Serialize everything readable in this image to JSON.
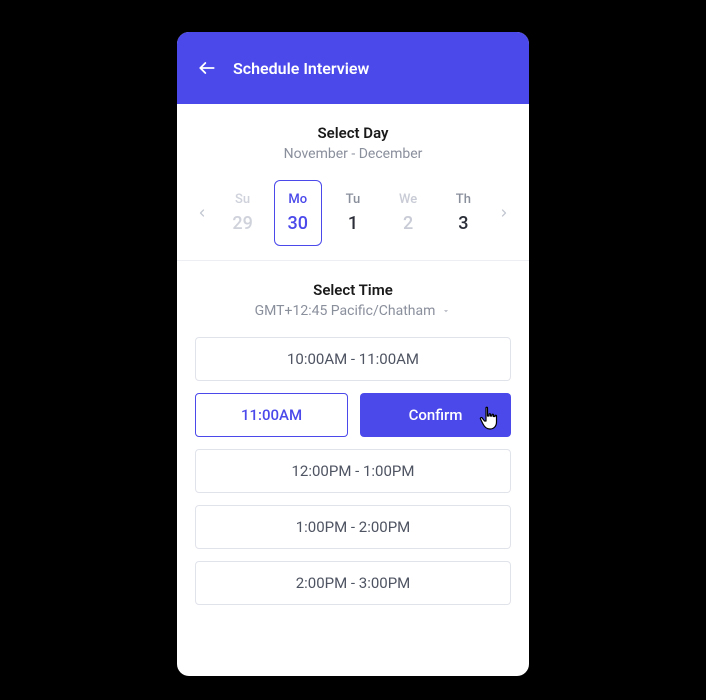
{
  "header": {
    "title": "Schedule Interview"
  },
  "daySection": {
    "title": "Select Day",
    "rangeLabel": "November - December",
    "days": [
      {
        "dow": "Su",
        "num": "29",
        "state": "disabled"
      },
      {
        "dow": "Mo",
        "num": "30",
        "state": "selected"
      },
      {
        "dow": "Tu",
        "num": "1",
        "state": "normal"
      },
      {
        "dow": "We",
        "num": "2",
        "state": "dim"
      },
      {
        "dow": "Th",
        "num": "3",
        "state": "normal"
      }
    ]
  },
  "timeSection": {
    "title": "Select Time",
    "timezone": "GMT+12:45 Pacific/Chatham",
    "slots": [
      "10:00AM - 11:00AM",
      "12:00PM - 1:00PM",
      "1:00PM - 2:00PM",
      "2:00PM - 3:00PM"
    ],
    "selectedShort": "11:00AM",
    "confirmLabel": "Confirm"
  }
}
